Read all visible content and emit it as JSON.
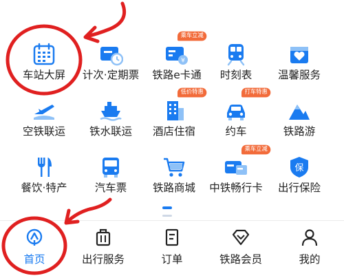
{
  "grid": {
    "row1": [
      {
        "label": "车站大屏",
        "icon": "calendar-icon"
      },
      {
        "label": "计次·定期票",
        "icon": "ticket-clock-icon"
      },
      {
        "label": "铁路e卡通",
        "icon": "e-card-icon",
        "badge": "乘车立减"
      },
      {
        "label": "时刻表",
        "icon": "train-icon"
      },
      {
        "label": "温馨服务",
        "icon": "heart-box-icon"
      }
    ],
    "row2": [
      {
        "label": "空铁联运",
        "icon": "plane-train-icon"
      },
      {
        "label": "铁水联运",
        "icon": "ship-icon"
      },
      {
        "label": "酒店住宿",
        "icon": "hotel-icon",
        "badge": "低价特惠"
      },
      {
        "label": "约车",
        "icon": "car-icon",
        "badge": "打车特惠"
      },
      {
        "label": "铁路游",
        "icon": "mountain-icon"
      }
    ],
    "row3": [
      {
        "label": "餐饮·特产",
        "icon": "fork-knife-icon"
      },
      {
        "label": "汽车票",
        "icon": "bus-icon"
      },
      {
        "label": "铁路商城",
        "icon": "shopping-cart-icon"
      },
      {
        "label": "中铁畅行卡",
        "icon": "cards-icon",
        "badge": "乘车立减"
      },
      {
        "label": "出行保险",
        "icon": "shield-insurance-icon",
        "icon_text": "保"
      }
    ]
  },
  "tabbar": [
    {
      "label": "首页",
      "icon": "home-icon",
      "active": true
    },
    {
      "label": "出行服务",
      "icon": "suitcase-icon"
    },
    {
      "label": "订单",
      "icon": "order-icon"
    },
    {
      "label": "铁路会员",
      "icon": "diamond-icon"
    },
    {
      "label": "我的",
      "icon": "user-icon"
    }
  ],
  "colors": {
    "accent": "#1a7bf0",
    "light_blue": "#8ec1f7",
    "badge": "#f26b3a",
    "annotation_red": "#e02020"
  }
}
